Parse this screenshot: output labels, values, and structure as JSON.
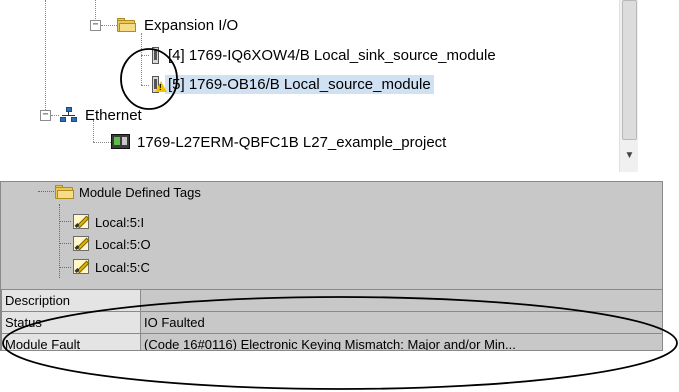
{
  "tree": {
    "expansion_io": "Expansion I/O",
    "module_4": "[4] 1769-IQ6XOW4/B Local_sink_source_module",
    "module_5": "[5] 1769-OB16/B Local_source_module",
    "ethernet": "Ethernet",
    "controller": "1769-L27ERM-QBFC1B L27_example_project"
  },
  "tags": {
    "folder": "Module Defined Tags",
    "items": [
      "Local:5:I",
      "Local:5:O",
      "Local:5:C"
    ]
  },
  "properties": [
    {
      "label": "Description",
      "value": ""
    },
    {
      "label": "Status",
      "value": "IO Faulted"
    },
    {
      "label": "Module Fault",
      "value": "(Code 16#0116) Electronic Keying Mismatch: Major and/or Min..."
    }
  ],
  "colors": {
    "selection": "#cfe1f3",
    "pane_background": "#c8c8c8",
    "warning": "#f2c300"
  },
  "icons": {
    "folder": "folder-icon",
    "module": "io-module-icon",
    "warning": "warning-icon",
    "network": "ethernet-network-icon",
    "controller": "controller-icon",
    "tag": "tag-icon"
  }
}
